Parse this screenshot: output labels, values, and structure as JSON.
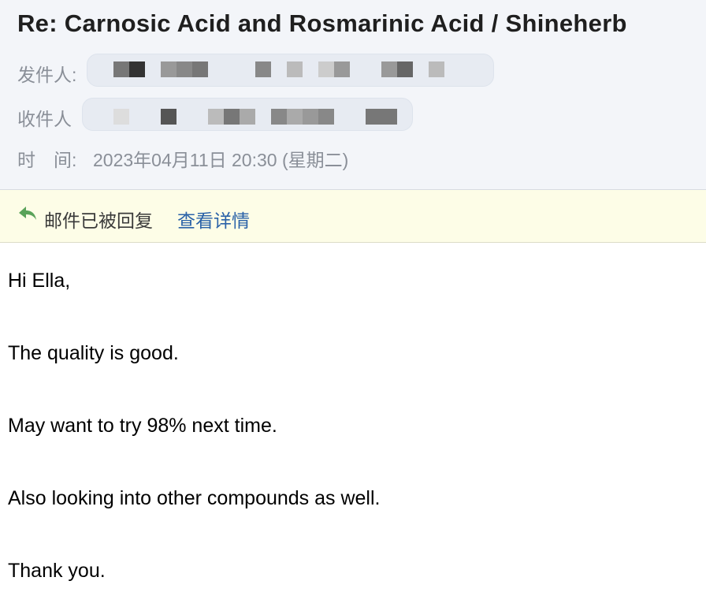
{
  "email": {
    "subject": "Re: Carnosic Acid and Rosmarinic Acid / Shineherb",
    "sender_label": "发件人:",
    "recipient_label": "收件人",
    "time_label": "时　间:",
    "time_value": "2023年04月11日 20:30 (星期二)"
  },
  "notice": {
    "icon": "reply-arrow-icon",
    "text": "邮件已被回复",
    "link": "查看详情"
  },
  "body": {
    "lines": [
      "Hi Ella,",
      "The quality is good.",
      "May want to try 98% next time.",
      "Also looking into other compounds as well.",
      "Thank you."
    ]
  },
  "colors": {
    "header_bg": "#f3f5f9",
    "notice_bg": "#fdfde7",
    "link": "#2a62a8",
    "reply_icon": "#5aa35a"
  }
}
